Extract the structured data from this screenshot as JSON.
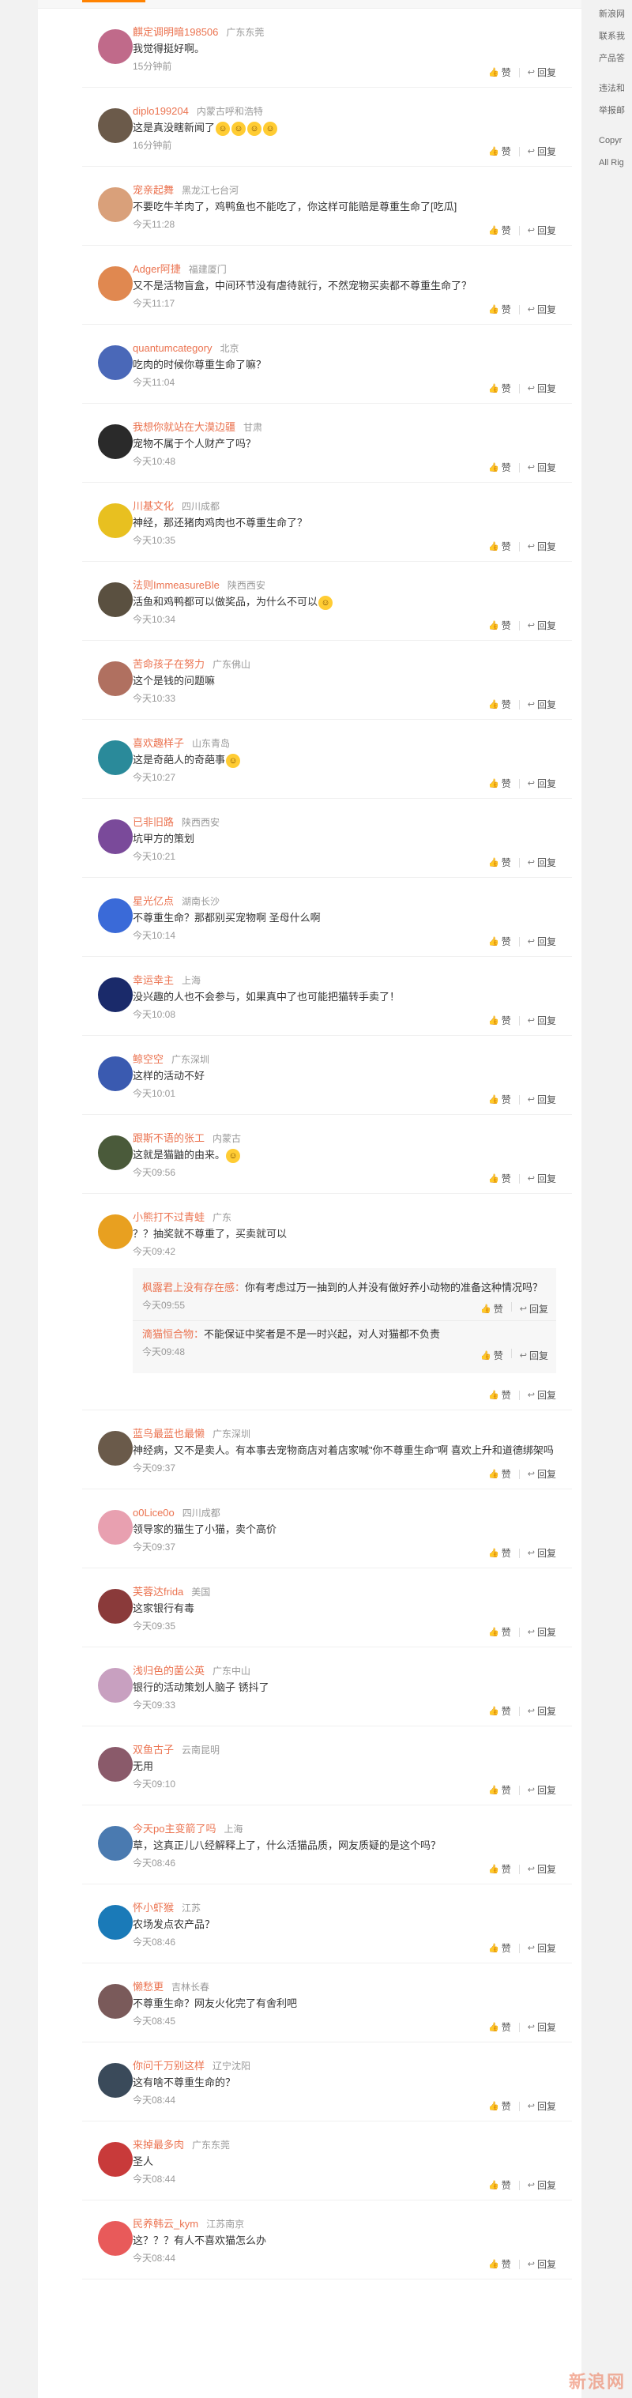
{
  "right_rail": {
    "items": [
      "新浪网",
      "联系我",
      "产品答",
      "违法和",
      "举报邮",
      "Copyr",
      "All Rig"
    ]
  },
  "actions": {
    "like": "赞",
    "reply": "回复"
  },
  "comments": [
    {
      "name": "麒定调明暗198506",
      "loc": "广东东莞",
      "text": "我觉得挺好啊。",
      "time": "15分钟前",
      "avatar_color": "#c06a8a"
    },
    {
      "name": "diplo199204",
      "loc": "内蒙古呼和浩特",
      "text": "这是真没瞎新闻了",
      "emoji_count": 4,
      "time": "16分钟前",
      "avatar_color": "#6b5a4a"
    },
    {
      "name": "宠亲起舞",
      "loc": "黑龙江七台河",
      "text": "不要吃牛羊肉了，鸡鸭鱼也不能吃了，你这样可能赔是尊重生命了[吃瓜]",
      "time": "今天11:28",
      "avatar_color": "#d9a07a"
    },
    {
      "name": "Adger阿捷",
      "loc": "福建厦门",
      "text": "又不是活物盲盒，中间环节没有虐待就行，不然宠物买卖都不尊重生命了？",
      "time": "今天11:17",
      "avatar_color": "#e08850"
    },
    {
      "name": "quantumcategory",
      "loc": "北京",
      "text": "吃肉的时候你尊重生命了嘛？",
      "time": "今天11:04",
      "avatar_color": "#4a68b8"
    },
    {
      "name": "我想你就站在大漠边疆",
      "loc": "甘肃",
      "text": "宠物不属于个人财产了吗？",
      "time": "今天10:48",
      "avatar_color": "#2a2a2a"
    },
    {
      "name": "川基文化",
      "loc": "四川成都",
      "text": "神经，那还猪肉鸡肉也不尊重生命了？",
      "time": "今天10:35",
      "avatar_color": "#e8c020"
    },
    {
      "name": "法则ImmeasureBle",
      "loc": "陕西西安",
      "text": "活鱼和鸡鸭都可以做奖品，为什么不可以",
      "emoji_mid": true,
      "time": "今天10:34",
      "avatar_color": "#5a5040"
    },
    {
      "name": "苦命孩子在努力",
      "loc": "广东佛山",
      "text": "这个是钱的问题嘛",
      "time": "今天10:33",
      "avatar_color": "#b07060"
    },
    {
      "name": "喜欢趣样子",
      "loc": "山东青岛",
      "text": "这是奇葩人的奇葩事",
      "emoji_end": true,
      "time": "今天10:27",
      "avatar_color": "#2a8a9a"
    },
    {
      "name": "已非旧路",
      "loc": "陕西西安",
      "text": "坑甲方的策划",
      "time": "今天10:21",
      "avatar_color": "#7a4a9a"
    },
    {
      "name": "星光亿点",
      "loc": "湖南长沙",
      "text": "不尊重生命？那都别买宠物啊 圣母什么啊",
      "time": "今天10:14",
      "avatar_color": "#3a6ad8"
    },
    {
      "name": "幸运幸主",
      "loc": "上海",
      "text": "没兴趣的人也不会参与，如果真中了也可能把猫转手卖了！",
      "time": "今天10:08",
      "avatar_color": "#1a2a6a"
    },
    {
      "name": "鲸空空",
      "loc": "广东深圳",
      "text": "这样的活动不好",
      "time": "今天10:01",
      "avatar_color": "#3a5ab0"
    },
    {
      "name": "跟斯不语的张工",
      "loc": "内蒙古",
      "text": "这就是猫鼬的由来。",
      "emoji_end": true,
      "time": "今天09:56",
      "avatar_color": "#4a5a3a"
    },
    {
      "name": "小熊打不过青蛙",
      "loc": "广东",
      "text": "？？抽奖就不尊重了，买卖就可以",
      "time": "今天09:42",
      "avatar_color": "#e8a020",
      "replies": [
        {
          "name": "枫露君上没有存在感",
          "text": "你有考虑过万一抽到的人并没有做好养小动物的准备这种情况吗？",
          "time": "今天09:55"
        },
        {
          "name": "滴猫恒合物",
          "text": "不能保证中奖者是不是一时兴起，对人对猫都不负责",
          "time": "今天09:48"
        }
      ]
    },
    {
      "name": "蓝鸟最蓝也最懒",
      "loc": "广东深圳",
      "text": "神经病，又不是卖人。有本事去宠物商店对着店家喊\"你不尊重生命\"啊 喜欢上升和道德绑架吗",
      "time": "今天09:37",
      "avatar_color": "#6a5a4a"
    },
    {
      "name": "o0Lice0o",
      "loc": "四川成都",
      "text": "领导家的猫生了小猫，卖个高价",
      "time": "今天09:37",
      "avatar_color": "#e8a0b0"
    },
    {
      "name": "芙蓉达frida",
      "loc": "美国",
      "text": "这家银行有毒",
      "time": "今天09:35",
      "avatar_color": "#8a3a3a"
    },
    {
      "name": "浅归色的菌公英",
      "loc": "广东中山",
      "text": "银行的活动策划人脑子 锈抖了",
      "time": "今天09:33",
      "avatar_color": "#c8a0c0"
    },
    {
      "name": "双鱼古子",
      "loc": "云南昆明",
      "text": "无用",
      "time": "今天09:10",
      "avatar_color": "#8a5a6a"
    },
    {
      "name": "今天po主变箭了吗",
      "loc": "上海",
      "text": "草，这真正儿八经解释上了，什么活猫品质，网友质疑的是这个吗？",
      "time": "今天08:46",
      "avatar_color": "#4a7ab0"
    },
    {
      "name": "怀小虾猴",
      "loc": "江苏",
      "text": "农场发点农产品？",
      "time": "今天08:46",
      "avatar_color": "#1a7ab8"
    },
    {
      "name": "懒愁更",
      "loc": "吉林长春",
      "text": "不尊重生命？网友火化完了有舍利吧",
      "time": "今天08:45",
      "avatar_color": "#7a5a5a"
    },
    {
      "name": "你问千万别这样",
      "loc": "辽宁沈阳",
      "text": "这有啥不尊重生命的？",
      "time": "今天08:44",
      "avatar_color": "#3a4a5a"
    },
    {
      "name": "来掉最多肉",
      "loc": "广东东莞",
      "text": "圣人",
      "time": "今天08:44",
      "avatar_color": "#c83a3a"
    },
    {
      "name": "民养韩云_kym",
      "loc": "江苏南京",
      "text": "这？？？有人不喜欢猫怎么办",
      "time": "今天08:44",
      "avatar_color": "#e85a5a"
    }
  ],
  "watermark": "新浪网"
}
